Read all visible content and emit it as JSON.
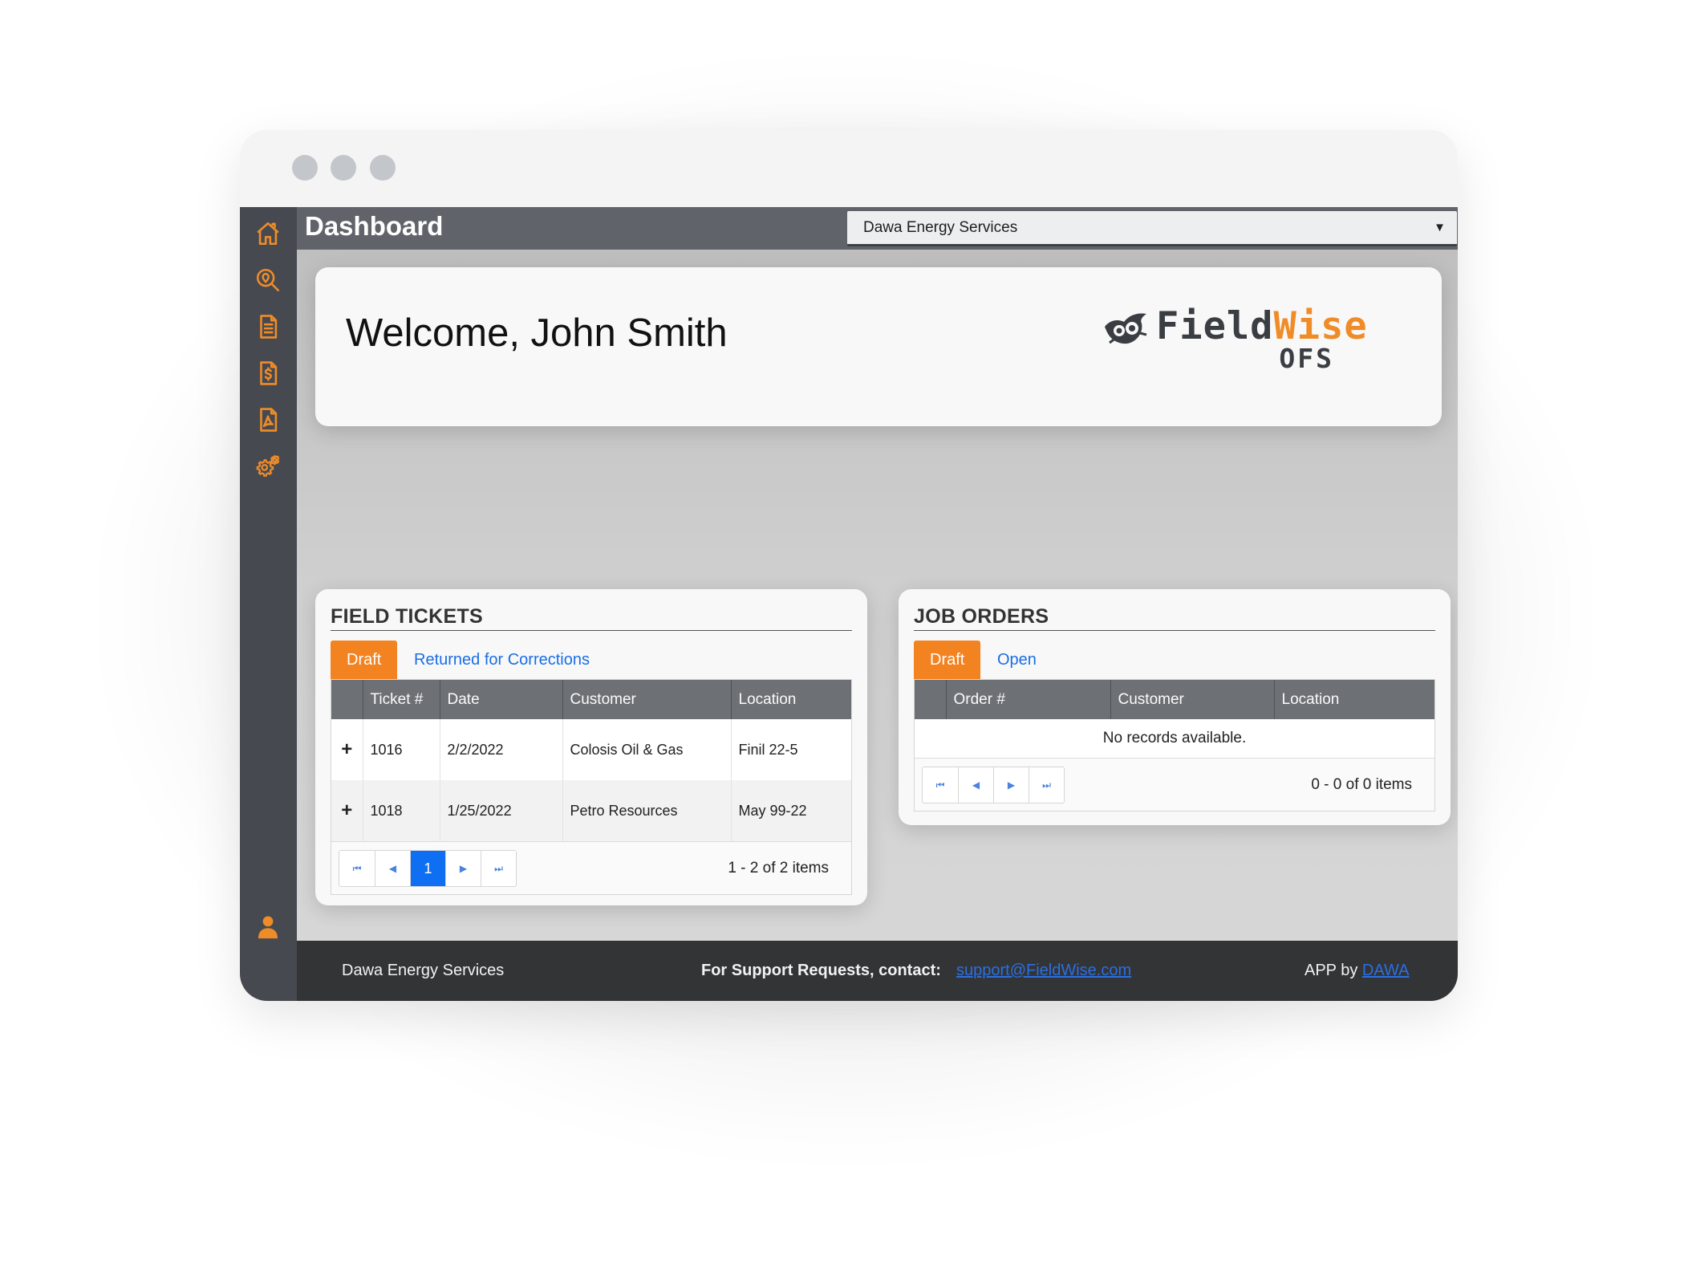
{
  "window": {
    "title": "Dashboard"
  },
  "sidebar": {
    "icons": [
      "home-icon",
      "map-search-icon",
      "document-icon",
      "invoice-icon",
      "pdf-icon",
      "settings-icon",
      "user-icon"
    ],
    "accent": "#f08c28"
  },
  "header": {
    "title": "Dashboard",
    "company_select": "Dawa Energy Services"
  },
  "welcome": {
    "text": "Welcome, John Smith",
    "logo_field": "Field",
    "logo_wise": "Wise",
    "logo_ofs": "OFS"
  },
  "field_tickets": {
    "title": "FIELD TICKETS",
    "tabs": [
      "Draft",
      "Returned for Corrections"
    ],
    "columns": [
      "Ticket #",
      "Date",
      "Customer",
      "Location"
    ],
    "rows": [
      {
        "expand": "+",
        "ticket": "1016",
        "date": "2/2/2022",
        "customer": "Colosis Oil & Gas",
        "location": "Finil 22-5"
      },
      {
        "expand": "+",
        "ticket": "1018",
        "date": "1/25/2022",
        "customer": "Petro Resources",
        "location": "May 99-22"
      }
    ],
    "pager": {
      "current_page": "1",
      "info": "1 - 2 of 2 items"
    }
  },
  "job_orders": {
    "title": "JOB ORDERS",
    "tabs": [
      "Draft",
      "Open"
    ],
    "columns": [
      "Order #",
      "Customer",
      "Location"
    ],
    "empty": "No records available.",
    "pager": {
      "info": "0 - 0 of 0 items"
    }
  },
  "footer": {
    "company": "Dawa Energy Services",
    "support_label": "For Support Requests, contact:",
    "support_email": "support@FieldWise.com",
    "app_by": "APP by",
    "app_by_link": "DAWA"
  },
  "colors": {
    "accent": "#f38220",
    "link": "#1a6ee6",
    "header": "#60646a",
    "sidebar": "#464a50"
  }
}
